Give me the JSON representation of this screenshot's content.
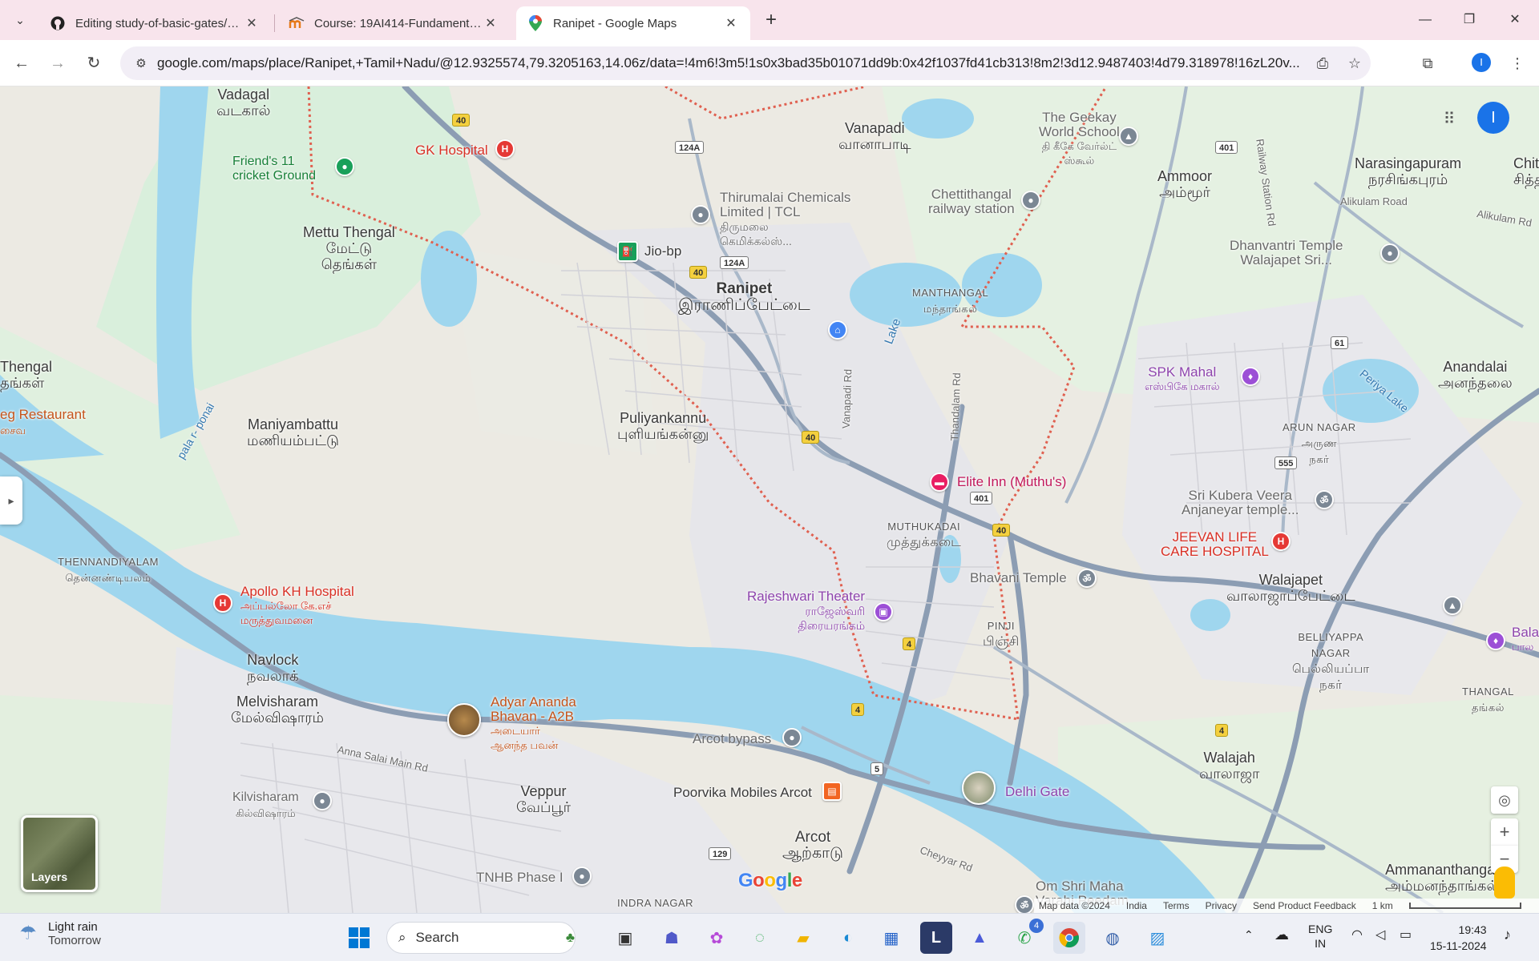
{
  "browser": {
    "tabs": [
      {
        "title": "Editing study-of-basic-gates/RE",
        "favicon": "github-icon"
      },
      {
        "title": "Course: 19AI414-Fundamentals",
        "favicon": "moodle-icon"
      },
      {
        "title": "Ranipet - Google Maps",
        "favicon": "maps-pin-icon",
        "active": true
      }
    ],
    "url": "google.com/maps/place/Ranipet,+Tamil+Nadu/@12.9325574,79.3205163,14.06z/data=!4m6!3m5!1s0x3bad35b01071dd9b:0x42f1037fd41cb313!8m2!3d12.9487403!4d79.318978!16zL20v...",
    "profile_initial": "I"
  },
  "map": {
    "account_initial": "I",
    "layers_label": "Layers",
    "google_logo": "Google",
    "footer": {
      "map_data": "Map data ©2024",
      "country": "India",
      "terms": "Terms",
      "privacy": "Privacy",
      "feedback": "Send Product Feedback",
      "scale": "1 km"
    },
    "places": {
      "vadagal": "Vadagal",
      "vadagal_ta": "வடகால்",
      "friends": "Friend's 11\ncricket Ground",
      "gk_hospital": "GK Hospital",
      "mettu": "Mettu Thengal",
      "mettu_ta1": "மேட்டு",
      "mettu_ta2": "தெங்கள்",
      "thengal": "Thengal",
      "thengal_ta": "தங்கள்",
      "restaurant": "eg Restaurant",
      "restaurant_ta": "சைவ",
      "maniyambattu": "Maniyambattu",
      "maniyambattu_ta": "மணியம்பட்டு",
      "palar": "pala r- ponai",
      "thennandiyalam": "THENNANDIYALAM",
      "thennandiyalam_ta": "தென்னண்டியலம்",
      "apollo": "Apollo KH Hospital",
      "apollo_ta1": "அப்பல்லோ கே.எச்",
      "apollo_ta2": "மருத்துவமனை",
      "navlock": "Navlock",
      "navlock_ta": "நவலாக்",
      "melvisharam": "Melvisharam",
      "melvisharam_ta": "மேல்விஷாரம்",
      "anna_salai": "Anna Salai Main Rd",
      "kilvisharam": "Kilvisharam",
      "kilvisharam_ta": "கில்விஷாரம்",
      "adyar1": "Adyar Ananda",
      "adyar2": "Bhavan - A2B",
      "adyar_ta1": "அடையார்",
      "adyar_ta2": "ஆனந்த பவன்",
      "veppur": "Veppur",
      "veppur_ta": "வேப்பூர்",
      "tnhb": "TNHB Phase I",
      "indra": "INDRA NAGAR",
      "jio": "Jio-bp",
      "ranipet": "Ranipet",
      "ranipet_ta": "இராணிப்பேட்டை",
      "thirumalai1": "Thirumalai Chemicals",
      "thirumalai2": "Limited | TCL",
      "thirumalai_ta1": "திருமலை",
      "thirumalai_ta2": "கெமிக்கல்ஸ்...",
      "puliyankannu": "Puliyankannu",
      "puliyankannu_ta": "புளியங்கன்னு",
      "vanapadi": "Vanapadi",
      "vanapadi_ta": "வானாபாடி",
      "vanapadi_rd": "Vanapadi Rd",
      "thandalam_rd": "Thandalam Rd",
      "lake": "Lake",
      "manthangal": "MANTHANGAL",
      "manthangal_ta": "மந்தாங்கல்",
      "geekay1": "The Geekay",
      "geekay2": "World School",
      "geekay_ta1": "தி கீகே வேர்ல்ட்",
      "geekay_ta2": "ஸ்கூல்",
      "chettithangal1": "Chettithangal",
      "chettithangal2": "railway station",
      "elite": "Elite Inn (Muthu's)",
      "muthukadai": "MUTHUKADAI",
      "muthukadai_ta": "முத்துக்கடை",
      "rajeshwari": "Rajeshwari Theater",
      "rajeshwari_ta1": "ராஜேஸ்வரி",
      "rajeshwari_ta2": "திரையரங்கம்",
      "pinji": "PINJI",
      "pinji_ta": "பிஞ்சி",
      "bhavani": "Bhavani Temple",
      "arcot_bypass": "Arcot bypass",
      "poorvika": "Poorvika Mobiles Arcot",
      "arcot": "Arcot",
      "arcot_ta": "ஆற்காடு",
      "delhi_gate": "Delhi Gate",
      "cheyyar_rd": "Cheyyar Rd",
      "om_shri1": "Om Shri Maha",
      "om_shri2": "Varahi Peedam",
      "ammoor": "Ammoor",
      "ammoor_ta": "அம்மூர்",
      "railway_rd": "Railway Station Rd",
      "narasingapuram": "Narasingapuram",
      "narasingapuram_ta": "நரசிங்கபுரம்",
      "chithat": "Chithat",
      "chithat_ta": "சித்தா",
      "alikulam_rd": "Alikulam Road",
      "alikulam_rd2": "Alikulam Rd",
      "dhanvantri1": "Dhanvantri Temple",
      "dhanvantri2": "Walajapet Sri...",
      "spk": "SPK Mahal",
      "spk_ta": "எஸ்பிகே மகால்",
      "anandalai": "Anandalai",
      "anandalai_ta": "அனந்தலை",
      "periya_lake": "Periya Lake",
      "arun_nagar": "ARUN NAGAR",
      "arun_nagar_ta1": "அருண",
      "arun_nagar_ta2": "நகர்",
      "kubera1": "Sri Kubera Veera",
      "kubera2": "Anjaneyar temple...",
      "jeevan1": "JEEVAN LIFE",
      "jeevan2": "CARE HOSPITAL",
      "walajapet": "Walajapet",
      "walajapet_ta": "வாலாஜாப்பேட்டை",
      "belliyappa1": "BELLIYAPPA",
      "belliyappa2": "NAGAR",
      "belliyappa_ta1": "பெல்லியப்பா",
      "belliyappa_ta2": "நகர்",
      "bala": "Bala",
      "bala_ta": "பால",
      "thangal": "THANGAL",
      "thangal_ta": "தங்கல்",
      "walajah": "Walajah",
      "walajah_ta": "வாலாஜா",
      "ammananthangal": "Ammananthangal",
      "ammananthangal_ta": "அம்மனந்தாங்கல்"
    },
    "shields": {
      "s40": "40",
      "s124a": "124A",
      "s401": "401",
      "s4": "4",
      "s5": "5",
      "s129": "129",
      "s61": "61",
      "s555": "555"
    }
  },
  "taskbar": {
    "weather_title": "Light rain",
    "weather_sub": "Tomorrow",
    "search_label": "Search",
    "teams_badge": "4",
    "lang1": "ENG",
    "lang2": "IN",
    "time": "19:43",
    "date": "15-11-2024"
  }
}
